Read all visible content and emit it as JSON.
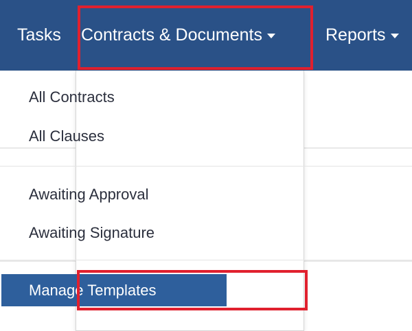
{
  "navbar": {
    "items": [
      {
        "label": "Tasks",
        "has_dropdown": false
      },
      {
        "label": "Contracts & Documents",
        "has_dropdown": true
      },
      {
        "label": "Reports",
        "has_dropdown": true
      }
    ]
  },
  "dropdown": {
    "groups": [
      {
        "items": [
          "All Contracts",
          "All Clauses"
        ]
      },
      {
        "items": [
          "Awaiting Approval",
          "Awaiting Signature"
        ]
      },
      {
        "items": [
          "Manage Templates"
        ]
      }
    ]
  },
  "annotations": {
    "highlight_color": "#e0202e"
  },
  "colors": {
    "navbar_bg": "#2a5187",
    "active_item_bg": "#2e5f9c",
    "menu_text": "#2b2f3d"
  },
  "icons": [
    "caret-down-icon"
  ]
}
